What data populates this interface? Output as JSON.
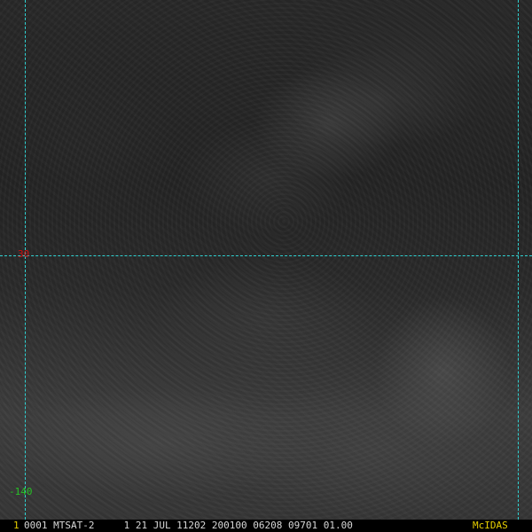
{
  "image": {
    "description_colors": {
      "grid_line": "#2fd3d3",
      "latitude_label": "#d01010",
      "longitude_label": "#27c227",
      "frame_number": "#e8d000",
      "status_text": "#d8d8d8",
      "brand": "#e8d000"
    }
  },
  "grid": {
    "latitude_label": "30",
    "longitude_label": "-140"
  },
  "status_bar": {
    "frame_number": "1",
    "text": "0001 MTSAT-2     1 21 JUL 11202 200100 06208 09701 01.00",
    "brand": "McIDAS"
  }
}
